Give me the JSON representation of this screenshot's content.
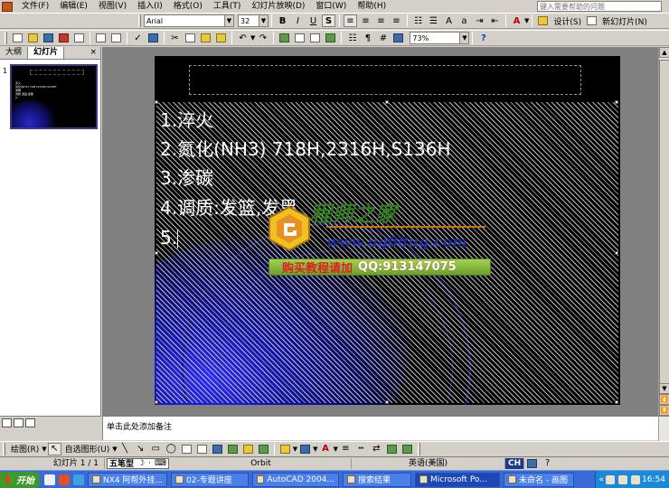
{
  "menu": {
    "items": [
      "文件(F)",
      "编辑(E)",
      "视图(V)",
      "插入(I)",
      "格式(O)",
      "工具(T)",
      "幻灯片放映(D)",
      "窗口(W)",
      "帮助(H)"
    ],
    "help_placeholder": "键入需要帮助的问题"
  },
  "format_toolbar": {
    "font_name": "Arial",
    "font_size": "32",
    "bold_label": "B",
    "italic_label": "I",
    "underline_label": "U",
    "shadow_label": "S",
    "design_label": "设计(S)",
    "new_slide_label": "新幻灯片(N)"
  },
  "standard_toolbar": {
    "zoom": "73%"
  },
  "left_pane": {
    "tabs": [
      "大纲",
      "幻灯片"
    ],
    "close_label": "×",
    "slide_number": "1",
    "thumb_lines": [
      "淬火",
      "氮化(NH3)   718H,2316H,S136H",
      "渗碳",
      "调质 发篮,发黑",
      "5."
    ]
  },
  "slide": {
    "lines": [
      "1.淬火",
      "2.氮化(NH3)      718H,2316H,S136H",
      "3.渗碳",
      "4.调质:发篮,发黑",
      "5."
    ]
  },
  "watermark": {
    "title": "程师之家",
    "url": "www.ug88ug.com",
    "buy": "购买教程请加",
    "qq": "QQ:913147075"
  },
  "notes": {
    "placeholder": "单击此处添加备注"
  },
  "drawing_toolbar": {
    "draw_label": "绘图(R)",
    "autoshapes_label": "自选图形(U)",
    "wubi_label": "五笔型"
  },
  "status": {
    "slide_indicator": "幻灯片 1 / 1",
    "design_name": "Orbit",
    "language": "英语(美国)",
    "ime": "CH"
  },
  "taskbar": {
    "start_label": "开始",
    "tasks": [
      "NX4 阿帮外挂...",
      "02-专题讲座",
      "AutoCAD 2004...",
      "搜索结果",
      "Microsoft Po...",
      "未命名 - 画图"
    ],
    "clock": "16:54"
  }
}
